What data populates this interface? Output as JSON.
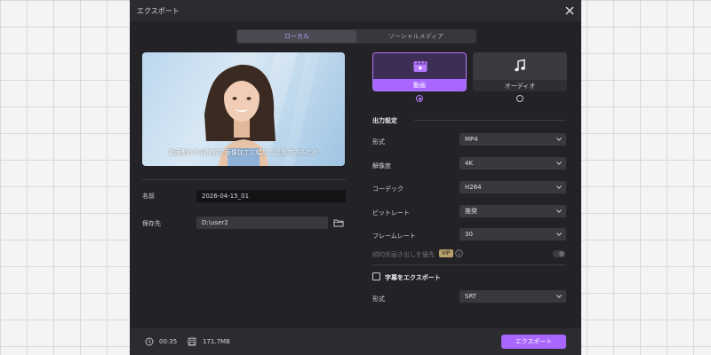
{
  "dialog": {
    "title": "エクスポート"
  },
  "tabs": [
    {
      "label": "ローカル",
      "active": true
    },
    {
      "label": "ソーシャルメディア",
      "active": false
    }
  ],
  "preview": {
    "caption": "動画制作や日常的な画像加工に幅広く活用できるため"
  },
  "left_form": {
    "name_label": "名前",
    "name_value": "2026-04-15_01",
    "save_label": "保存先",
    "save_value": "D:\\user2"
  },
  "export_types": [
    {
      "label": "動画",
      "icon": "video-icon",
      "selected": true
    },
    {
      "label": "オーディオ",
      "icon": "music-note-icon",
      "selected": false
    }
  ],
  "output_settings": {
    "title": "出力設定",
    "rows": [
      {
        "label": "形式",
        "value": "MP4"
      },
      {
        "label": "解像度",
        "value": "4K"
      },
      {
        "label": "コーデック",
        "value": "H264"
      },
      {
        "label": "ビットレート",
        "value": "推奨"
      },
      {
        "label": "フレームレート",
        "value": "30"
      }
    ],
    "quality_priority_label": "順的优画き出しを優先",
    "vip_badge": "VIP",
    "quality_toggle_on": false
  },
  "subtitle_export": {
    "label": "字幕をエクスポート",
    "checked": false,
    "format_label": "形式",
    "format_value": "SRT"
  },
  "footer": {
    "duration": "00:35",
    "size": "171.7MB",
    "export_button": "エクスポート"
  },
  "colors": {
    "accent": "#a866ff",
    "dialog_bg": "#232327"
  }
}
